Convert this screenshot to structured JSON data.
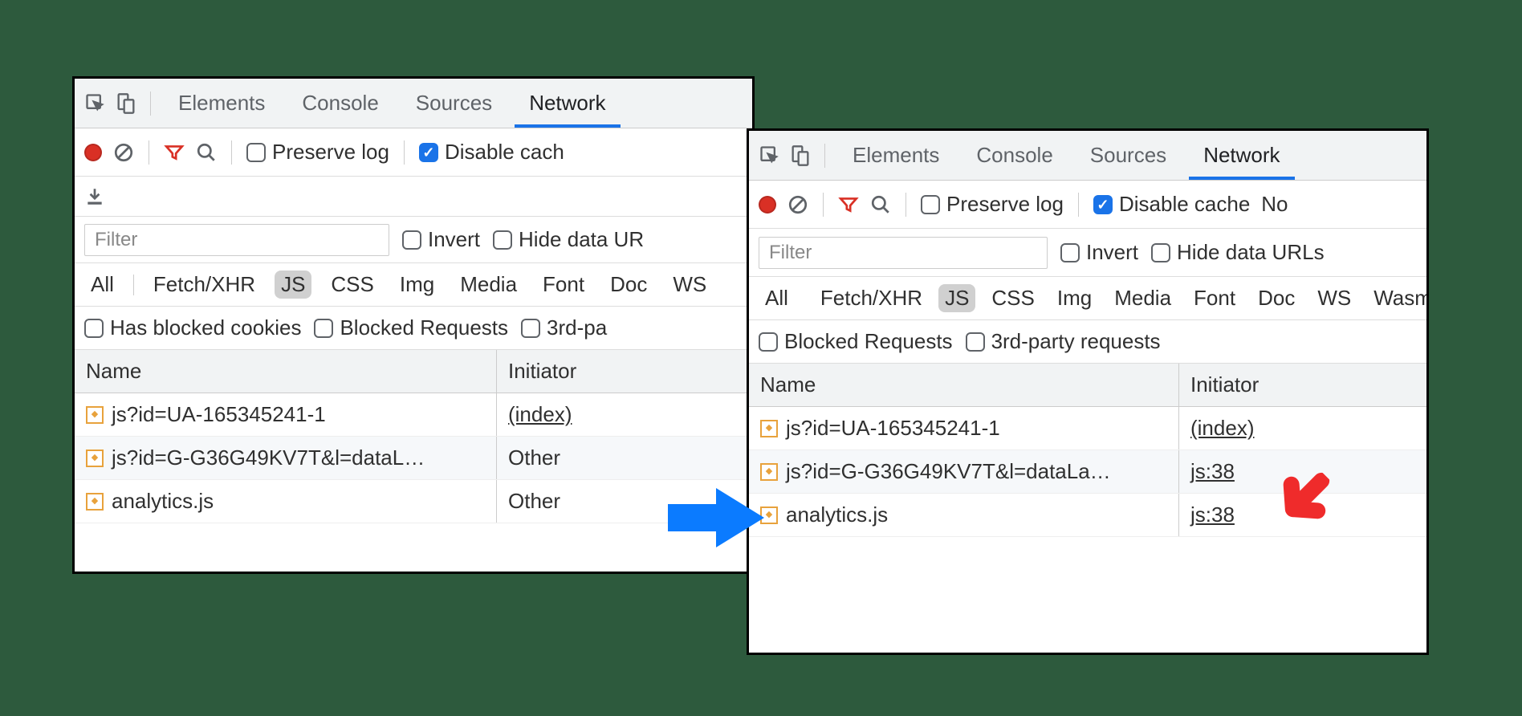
{
  "panels": [
    {
      "tabs": [
        "Elements",
        "Console",
        "Sources",
        "Network"
      ],
      "activeTab": "Network",
      "toolbar": {
        "preserve_log": "Preserve log",
        "disable_cache": "Disable cach"
      },
      "filter_placeholder": "Filter",
      "filter_row": {
        "invert": "Invert",
        "hide_urls": "Hide data UR"
      },
      "types": [
        "All",
        "Fetch/XHR",
        "JS",
        "CSS",
        "Img",
        "Media",
        "Font",
        "Doc",
        "WS"
      ],
      "selected_type": "JS",
      "flags_row": {
        "blocked_cookies": "Has blocked cookies",
        "blocked_req": "Blocked Requests",
        "third_party": "3rd-pa"
      },
      "columns": {
        "name": "Name",
        "initiator": "Initiator"
      },
      "col_widths": {
        "name": 525,
        "initiator": 310
      },
      "rows": [
        {
          "name": "js?id=UA-165345241-1",
          "initiator": "(index)",
          "initiator_link": true
        },
        {
          "name": "js?id=G-G36G49KV7T&l=dataL…",
          "initiator": "Other",
          "initiator_link": false
        },
        {
          "name": "analytics.js",
          "initiator": "Other",
          "initiator_link": false
        }
      ]
    },
    {
      "tabs": [
        "Elements",
        "Console",
        "Sources",
        "Network"
      ],
      "activeTab": "Network",
      "toolbar": {
        "preserve_log": "Preserve log",
        "disable_cache": "Disable cache",
        "tail": "No"
      },
      "filter_placeholder": "Filter",
      "filter_row": {
        "invert": "Invert",
        "hide_urls": "Hide data URLs"
      },
      "types": [
        "All",
        "Fetch/XHR",
        "JS",
        "CSS",
        "Img",
        "Media",
        "Font",
        "Doc",
        "WS",
        "Wasm"
      ],
      "selected_type": "JS",
      "flags_row": {
        "blocked_req": "Blocked Requests",
        "third_party": "3rd-party requests"
      },
      "columns": {
        "name": "Name",
        "initiator": "Initiator"
      },
      "col_widths": {
        "name": 535,
        "initiator": 300
      },
      "rows": [
        {
          "name": "js?id=UA-165345241-1",
          "initiator": "(index)",
          "initiator_link": true
        },
        {
          "name": "js?id=G-G36G49KV7T&l=dataLa…",
          "initiator": "js:38",
          "initiator_link": true
        },
        {
          "name": "analytics.js",
          "initiator": "js:38",
          "initiator_link": true
        }
      ]
    }
  ]
}
